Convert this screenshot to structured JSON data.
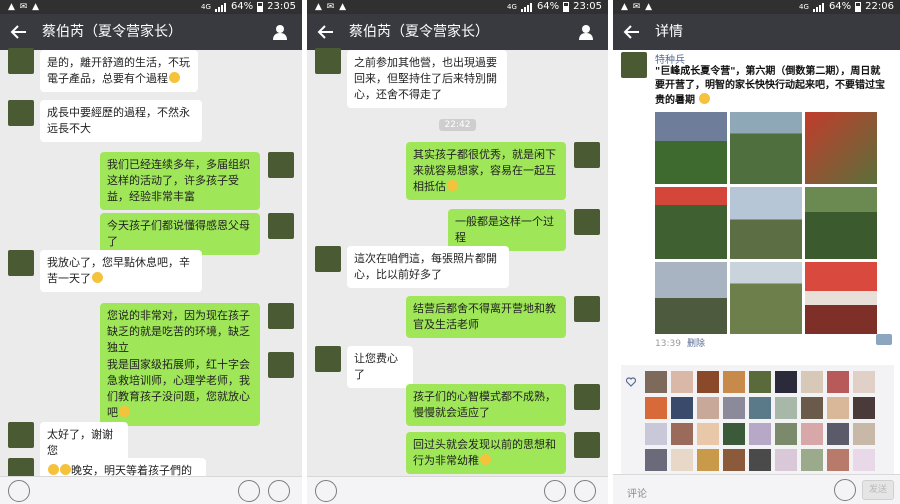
{
  "panels": [
    {
      "status": {
        "time": "23:05",
        "battery": "64%",
        "network": "4G"
      },
      "title": "蔡伯芮（夏令营家长）",
      "messages": [
        {
          "side": "left",
          "text": "是的，離开舒適的生活，不玩電子產品，总要有个過程"
        },
        {
          "side": "left",
          "text": "成長中要經歷的過程，不然永远長不大"
        },
        {
          "side": "right",
          "text": "我们已经连续多年，多届组织这样的活动了，许多孩子受益，经验非常丰富"
        },
        {
          "side": "right",
          "text": "今天孩子们都说懂得感恩父母了"
        },
        {
          "side": "left",
          "text": "我放心了，您早點休息吧，辛苦一天了"
        },
        {
          "side": "right",
          "text": "您说的非常对，因为现在孩子缺乏的就是吃苦的环境，缺乏独立"
        },
        {
          "side": "right",
          "text": "我是国家级拓展师，红十字会急救培训师，心理学老师，我们教育孩子没问题，您就放心吧"
        },
        {
          "side": "left",
          "text": "太好了，谢谢您"
        },
        {
          "side": "left",
          "text": "晚安，明天等着孩子們的"
        }
      ]
    },
    {
      "status": {
        "time": "23:05",
        "battery": "64%",
        "network": "4G"
      },
      "title": "蔡伯芮（夏令营家长）",
      "timestamp": "22:42",
      "messages": [
        {
          "side": "left",
          "text": "之前参加其他營，也出現過要回来，但堅持住了后来特別開心，还舍不得走了"
        },
        {
          "side": "right",
          "text": "其实孩子都很优秀，就是闲下来就容易想家，容易在一起互相抵估"
        },
        {
          "side": "right",
          "text": "一般都是这样一个过程"
        },
        {
          "side": "left",
          "text": "這次在咱們這，每張照片都開心，比以前好多了"
        },
        {
          "side": "right",
          "text": "结营后都舍不得离开营地和教官及生活老师"
        },
        {
          "side": "left",
          "text": "让您费心了"
        },
        {
          "side": "right",
          "text": "孩子们的心智模式都不成熟，慢慢就会适应了"
        },
        {
          "side": "right",
          "text": "回过头就会发现以前的思想和行为非常幼稚"
        }
      ]
    },
    {
      "status": {
        "time": "22:06",
        "battery": "64%",
        "network": "4G"
      },
      "title": "详情",
      "poster": "特种兵",
      "post_text": "\"巨峰成长夏令营\"，第六期（倒数第二期），周日就要开营了，明智的家长快快行动起来吧，不要错过宝贵的暑期",
      "time": "13:39",
      "delete_label": "删除",
      "comment_placeholder": "评论",
      "send_label": "发送"
    }
  ],
  "colors": {
    "titlebar": "#393a3f",
    "chat_bg": "#ebebeb",
    "bubble_sent": "#9fe658",
    "bubble_received": "#ffffff",
    "link": "#576b95"
  }
}
